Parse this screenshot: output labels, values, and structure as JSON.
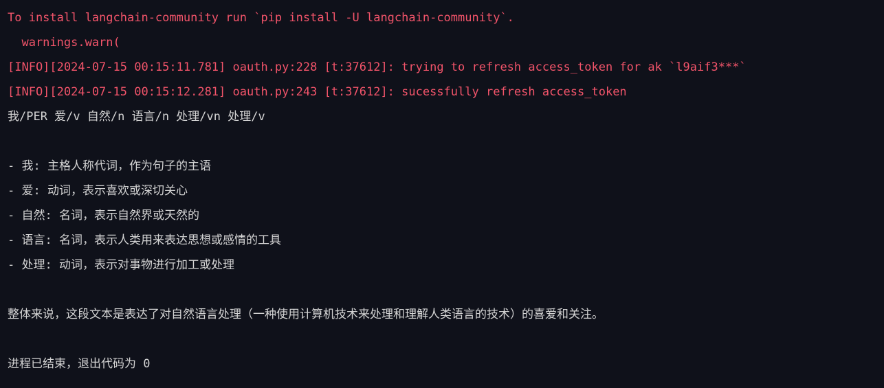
{
  "console": {
    "lines": [
      {
        "kind": "stderr",
        "text": "To install langchain-community run `pip install -U langchain-community`."
      },
      {
        "kind": "stderr",
        "text": "  warnings.warn("
      },
      {
        "kind": "stderr",
        "text": "[INFO][2024-07-15 00:15:11.781] oauth.py:228 [t:37612]: trying to refresh access_token for ak `l9aif3***`"
      },
      {
        "kind": "stderr",
        "text": "[INFO][2024-07-15 00:15:12.281] oauth.py:243 [t:37612]: sucessfully refresh access_token"
      },
      {
        "kind": "stdout",
        "text": "我/PER 爱/v 自然/n 语言/n 处理/vn 处理/v"
      },
      {
        "kind": "stdout",
        "text": "- 我: 主格人称代词，作为句子的主语"
      },
      {
        "kind": "stdout",
        "text": "- 爱: 动词，表示喜欢或深切关心"
      },
      {
        "kind": "stdout",
        "text": "- 自然: 名词，表示自然界或天然的"
      },
      {
        "kind": "stdout",
        "text": "- 语言: 名词，表示人类用来表达思想或感情的工具"
      },
      {
        "kind": "stdout",
        "text": "- 处理: 动词，表示对事物进行加工或处理"
      },
      {
        "kind": "stdout",
        "text": "整体来说，这段文本是表达了对自然语言处理（一种使用计算机技术来处理和理解人类语言的技术）的喜爱和关注。"
      },
      {
        "kind": "stdout",
        "text": "进程已结束，退出代码为 0"
      }
    ]
  },
  "colors": {
    "background": "#0f111a",
    "stderr": "#f2546a",
    "stdout": "#d4d4d4"
  }
}
